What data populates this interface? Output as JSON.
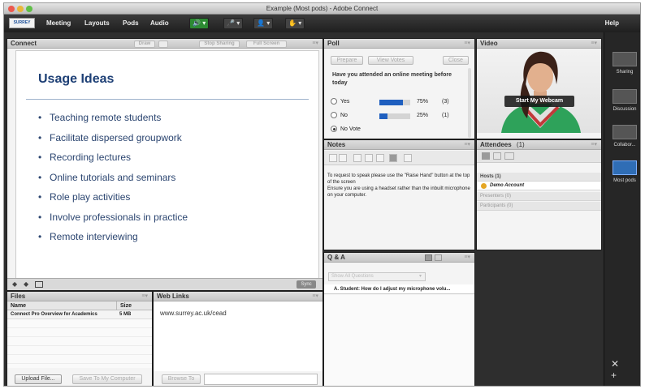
{
  "window": {
    "title": "Example (Most pods) - Adobe Connect"
  },
  "menubar": {
    "logo_text": "SURREY",
    "items": [
      "Meeting",
      "Layouts",
      "Pods",
      "Audio"
    ],
    "help": "Help",
    "glyph_caret": "▾",
    "glyph_speaker": "🔊",
    "glyph_mic": "🎤",
    "glyph_camera": "👤",
    "glyph_raise_hand": "✋"
  },
  "connect_pod": {
    "title": "Connect",
    "menu_glyph": "≡▾",
    "toolbar": {
      "draw": "Draw",
      "stop_sharing": "Stop Sharing",
      "full_screen": "Full Screen"
    },
    "slide": {
      "title": "Usage Ideas",
      "bullets": [
        "Teaching remote students",
        "Facilitate dispersed groupwork",
        "Recording lectures",
        "Online tutorials and seminars",
        "Role play activities",
        "Involve professionals in practice",
        "Remote interviewing"
      ]
    },
    "footer": {
      "prev": "◆",
      "next": "◆",
      "sync": "Sync"
    }
  },
  "files_pod": {
    "title": "Files",
    "columns": [
      "Name",
      "Size"
    ],
    "rows": [
      {
        "name": "Connect Pro Overview for Academics",
        "size": "5 MB"
      }
    ],
    "upload": "Upload File...",
    "save": "Save To My Computer"
  },
  "weblinks_pod": {
    "title": "Web Links",
    "link": "www.surrey.ac.uk/cead",
    "browse": "Browse To"
  },
  "poll_pod": {
    "title": "Poll",
    "buttons": {
      "prepare": "Prepare",
      "view_votes": "View Votes",
      "close": "Close"
    },
    "question": "Have you attended an online meeting before today",
    "options": [
      {
        "label": "Yes",
        "percent": 75,
        "percent_text": "75%",
        "count": "(3)"
      },
      {
        "label": "No",
        "percent": 25,
        "percent_text": "25%",
        "count": "(1)"
      }
    ],
    "no_vote": "No Vote"
  },
  "notes_pod": {
    "title": "Notes",
    "text": "To request to speak please use the \"Raise Hand\" button at the top of the screen\nEnsure you are using a headset rather than the inbuilt microphone on your computer."
  },
  "qa_pod": {
    "title": "Q & A",
    "filter": "Show All Questions",
    "item": "A. Student: How do I adjust my microphone volu..."
  },
  "video_pod": {
    "title": "Video",
    "webcam_button": "Start My Webcam"
  },
  "attendees_pod": {
    "title": "Attendees",
    "count": "(1)",
    "hosts": "Hosts (1)",
    "host_user": "Demo Account",
    "presenters": "Presenters (0)",
    "participants": "Participants (0)"
  },
  "layouts_rail": {
    "items": [
      {
        "label": "Sharing"
      },
      {
        "label": "Discussion"
      },
      {
        "label": "Collabor..."
      },
      {
        "label": "Most pods"
      }
    ],
    "footer_tools": "✕ +"
  },
  "colors": {
    "accent_blue": "#1f5fbf",
    "audio_green": "#2c8a32",
    "slide_title": "#1d3f75"
  }
}
